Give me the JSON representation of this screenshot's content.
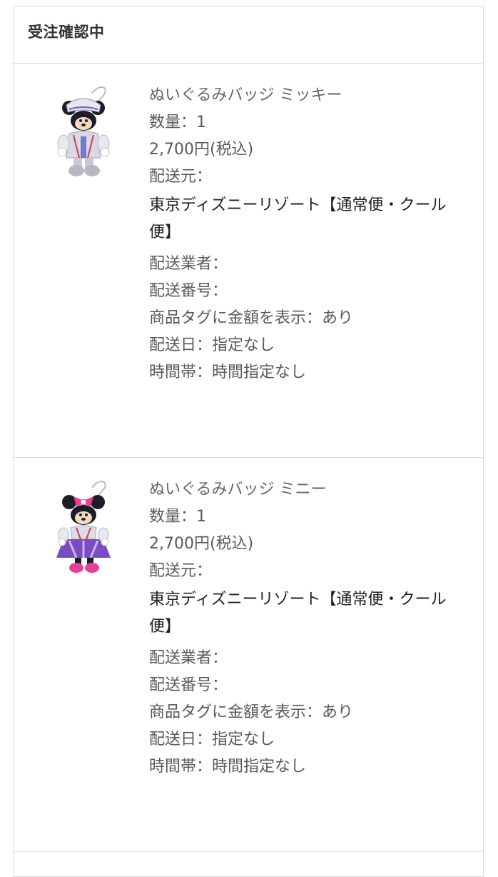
{
  "order": {
    "status": "受注確認中"
  },
  "items": [
    {
      "name": "ぬいぐるみバッジ ミッキー",
      "quantity": "数量：1",
      "price": "2,700円(税込)",
      "sender_label": "配送元：",
      "sender_value": "東京ディズニーリゾート【通常便・クール便】",
      "carrier": "配送業者：",
      "tracking": "配送番号：",
      "price_tag": "商品タグに金額を表示：あり",
      "delivery_date": "配送日：指定なし",
      "time_slot": "時間帯：時間指定なし",
      "image": "mickey-plush-badge"
    },
    {
      "name": "ぬいぐるみバッジ ミニー",
      "quantity": "数量：1",
      "price": "2,700円(税込)",
      "sender_label": "配送元：",
      "sender_value": "東京ディズニーリゾート【通常便・クール便】",
      "carrier": "配送業者：",
      "tracking": "配送番号：",
      "price_tag": "商品タグに金額を表示：あり",
      "delivery_date": "配送日：指定なし",
      "time_slot": "時間帯：時間指定なし",
      "image": "minnie-plush-badge"
    }
  ]
}
